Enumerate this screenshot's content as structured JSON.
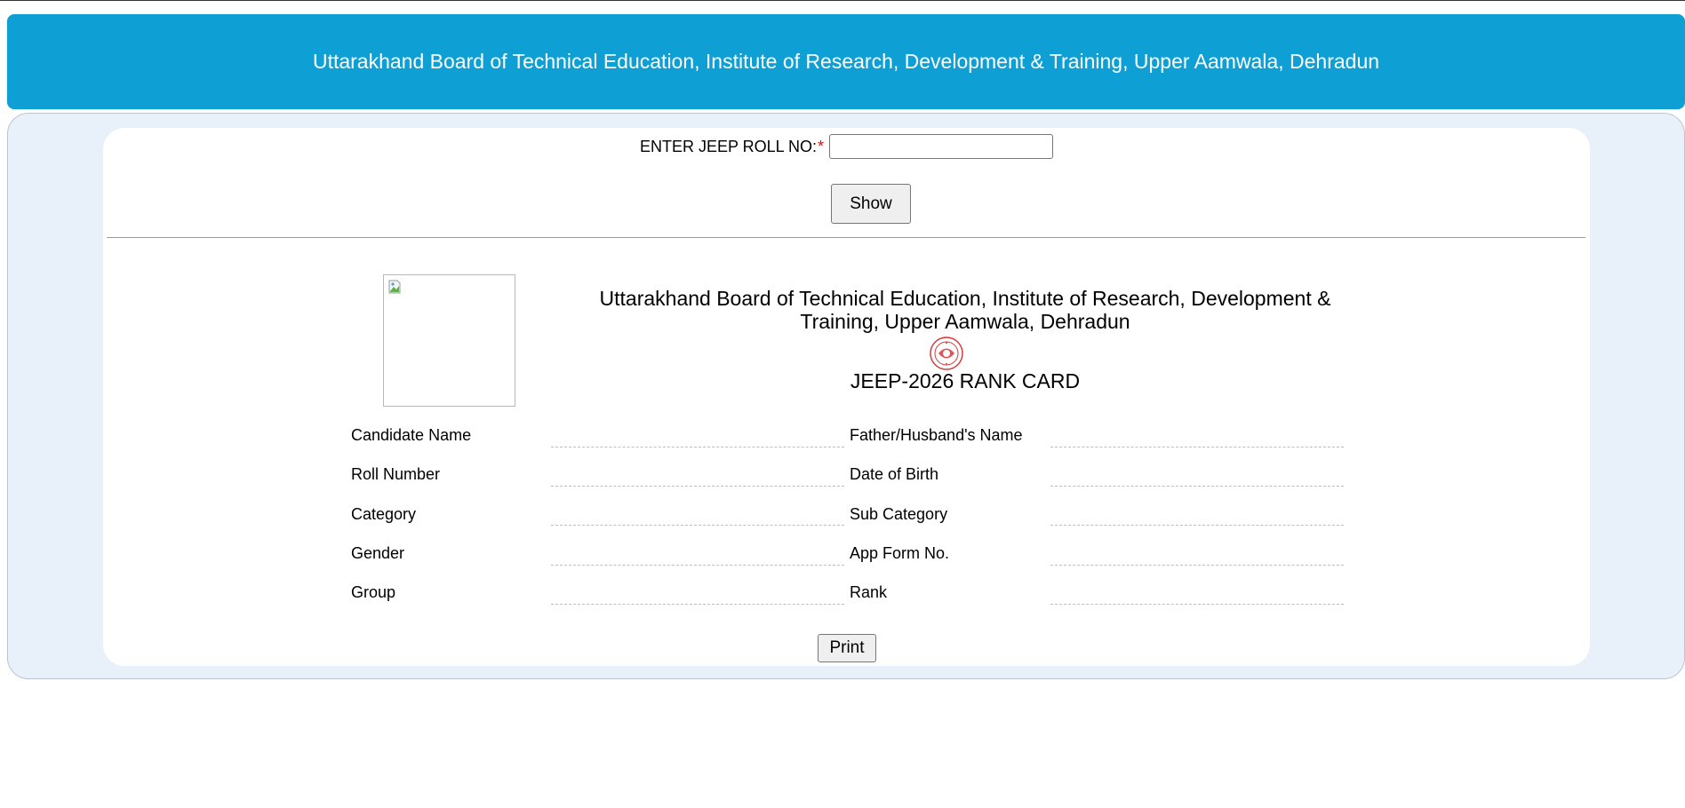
{
  "header": {
    "title": "Uttarakhand Board of Technical Education, Institute of Research, Development & Training, Upper Aamwala, Dehradun"
  },
  "form": {
    "roll_label": "ENTER JEEP ROLL NO:",
    "required_marker": "*",
    "roll_value": "",
    "roll_placeholder": "",
    "show_label": "Show"
  },
  "card": {
    "title": "Uttarakhand Board of Technical Education, Institute of Research, Development & Training, Upper Aamwala, Dehradun",
    "subtitle": "JEEP-2026 RANK CARD",
    "fields": {
      "candidate_name": {
        "label": "Candidate Name",
        "value": ""
      },
      "father_name": {
        "label": "Father/Husband's Name",
        "value": ""
      },
      "roll_number": {
        "label": "Roll Number",
        "value": ""
      },
      "dob": {
        "label": "Date of Birth",
        "value": ""
      },
      "category": {
        "label": "Category",
        "value": ""
      },
      "sub_category": {
        "label": "Sub Category",
        "value": ""
      },
      "gender": {
        "label": "Gender",
        "value": ""
      },
      "app_form_no": {
        "label": "App Form No.",
        "value": ""
      },
      "group": {
        "label": "Group",
        "value": ""
      },
      "rank": {
        "label": "Rank",
        "value": ""
      }
    },
    "print_label": "Print"
  },
  "icons": {
    "photo": "broken-image-icon",
    "emblem": "board-emblem-icon"
  },
  "colors": {
    "header_bg": "#0e9fd4",
    "panel_bg": "#e8f1f9",
    "required": "#dd1111"
  }
}
